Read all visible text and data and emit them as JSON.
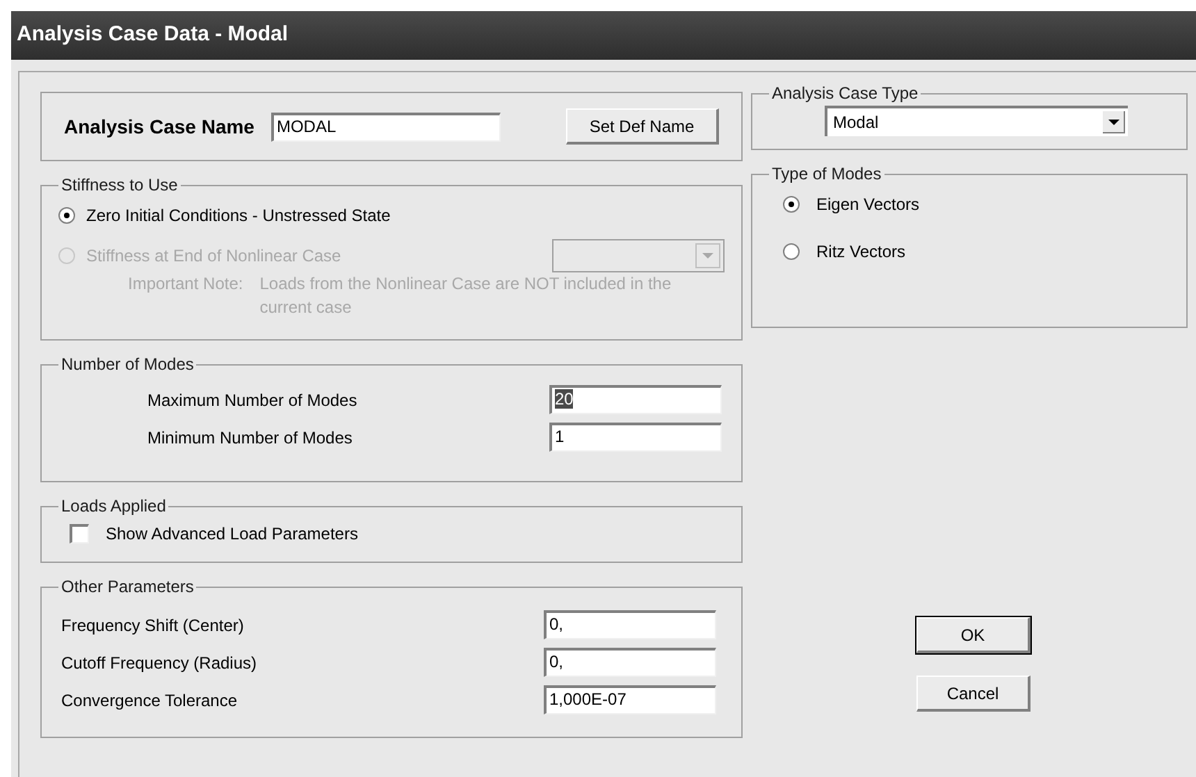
{
  "window": {
    "title": "Analysis Case Data - Modal"
  },
  "case_name": {
    "label": "Analysis Case Name",
    "value": "MODAL",
    "button": "Set Def Name"
  },
  "stiffness": {
    "title": "Stiffness to Use",
    "options": [
      {
        "label": "Zero Initial Conditions - Unstressed State",
        "selected": true,
        "disabled": false
      },
      {
        "label": "Stiffness at End of Nonlinear Case",
        "selected": false,
        "disabled": true
      }
    ],
    "dropdown": {
      "disabled": true
    },
    "note_label": "Important Note:",
    "note_text": "Loads from the Nonlinear Case are NOT included in the current case"
  },
  "number_of_modes": {
    "title": "Number of Modes",
    "fields": [
      {
        "label": "Maximum Number of Modes",
        "value": "20",
        "text_selected": true
      },
      {
        "label": "Minimum Number of Modes",
        "value": "1",
        "text_selected": false
      }
    ]
  },
  "loads_applied": {
    "title": "Loads Applied",
    "checkbox": {
      "label": "Show Advanced Load Parameters",
      "checked": false
    }
  },
  "other_parameters": {
    "title": "Other Parameters",
    "fields": [
      {
        "label": "Frequency Shift (Center)",
        "value": "0,"
      },
      {
        "label": "Cutoff Frequency (Radius)",
        "value": "0,"
      },
      {
        "label": "Convergence Tolerance",
        "value": "1,000E-07"
      }
    ]
  },
  "analysis_case_type": {
    "title": "Analysis Case Type",
    "value": "Modal"
  },
  "type_of_modes": {
    "title": "Type of Modes",
    "options": [
      {
        "label": "Eigen Vectors",
        "selected": true
      },
      {
        "label": "Ritz Vectors",
        "selected": false
      }
    ]
  },
  "buttons": [
    {
      "label": "OK",
      "default": true
    },
    {
      "label": "Cancel",
      "default": false
    }
  ]
}
